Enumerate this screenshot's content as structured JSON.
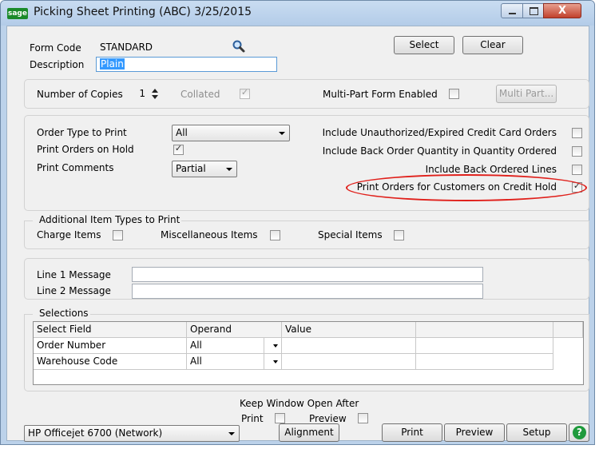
{
  "window": {
    "app_logo": "sage",
    "title": "Picking Sheet Printing (ABC) 3/25/2015",
    "close_glyph": "X"
  },
  "form": {
    "form_code_label": "Form Code",
    "form_code_value": "STANDARD",
    "description_label": "Description",
    "description_value": "Plain",
    "select_button": "Select",
    "clear_button": "Clear"
  },
  "copies": {
    "number_label": "Number of Copies",
    "number_value": "1",
    "collated_label": "Collated",
    "collated_checked": true,
    "multipart_label": "Multi-Part Form Enabled",
    "multipart_checked": false,
    "multipart_button": "Multi Part..."
  },
  "options": {
    "order_type_label": "Order Type to Print",
    "order_type_value": "All",
    "orders_on_hold_label": "Print Orders on Hold",
    "orders_on_hold_checked": true,
    "print_comments_label": "Print Comments",
    "print_comments_value": "Partial",
    "unauth_cc_label": "Include Unauthorized/Expired Credit Card Orders",
    "unauth_cc_checked": false,
    "backorder_qty_label": "Include Back Order Quantity in Quantity Ordered",
    "backorder_qty_checked": false,
    "backordered_lines_label": "Include Back Ordered Lines",
    "backordered_lines_checked": false,
    "credit_hold_label": "Print Orders for Customers on Credit Hold",
    "credit_hold_checked": true,
    "highlight_color": "#e0201b"
  },
  "item_types": {
    "group_label": "Additional Item Types to Print",
    "charge_label": "Charge Items",
    "charge_checked": false,
    "misc_label": "Miscellaneous Items",
    "misc_checked": false,
    "special_label": "Special Items",
    "special_checked": false
  },
  "messages": {
    "line1_label": "Line 1 Message",
    "line1_value": "",
    "line2_label": "Line 2 Message",
    "line2_value": ""
  },
  "selections": {
    "group_label": "Selections",
    "columns": [
      "Select Field",
      "Operand",
      "Value",
      ""
    ],
    "rows": [
      {
        "field": "Order Number",
        "operand": "All",
        "value": "",
        "extra": ""
      },
      {
        "field": "Warehouse Code",
        "operand": "All",
        "value": "",
        "extra": ""
      }
    ]
  },
  "footer": {
    "keep_open_label": "Keep Window Open After",
    "print_label": "Print",
    "print_checked": false,
    "preview_label": "Preview",
    "preview_checked": false,
    "printer_value": "HP Officejet 6700 (Network)",
    "alignment_button": "Alignment",
    "print_button": "Print",
    "preview_button": "Preview",
    "setup_button": "Setup",
    "help_glyph": "?"
  }
}
